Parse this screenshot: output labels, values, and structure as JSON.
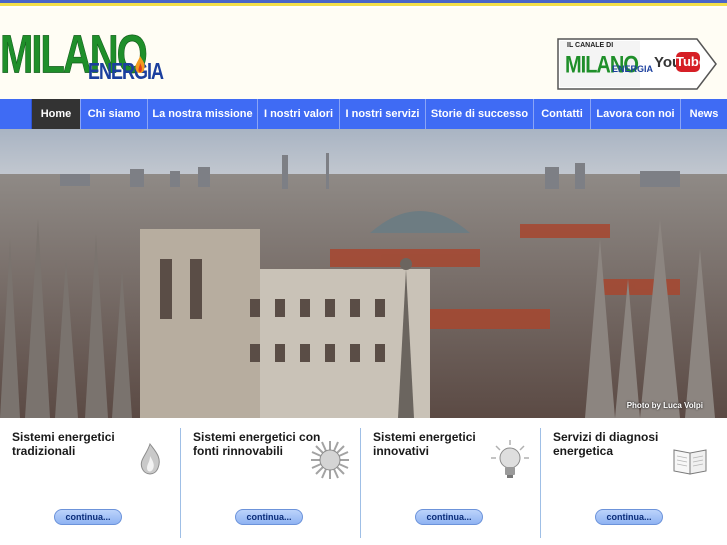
{
  "header": {
    "logo": {
      "word1": "MILANO",
      "word2": "ENERGIA"
    },
    "youtube_badge": {
      "caption": "IL CANALE DI",
      "word1": "MILANO",
      "word2": "ENERGIA",
      "you": "You",
      "tube": "Tube"
    }
  },
  "nav": {
    "items": [
      {
        "label": "Home",
        "active": true
      },
      {
        "label": "Chi siamo"
      },
      {
        "label": "La nostra missione"
      },
      {
        "label": "I nostri valori"
      },
      {
        "label": "I nostri servizi"
      },
      {
        "label": "Storie di successo"
      },
      {
        "label": "Contatti"
      },
      {
        "label": "Lavora con noi"
      },
      {
        "label": "News"
      }
    ]
  },
  "hero": {
    "credit": "Photo by Luca Volpi"
  },
  "services": [
    {
      "title": "Sistemi energetici tradizionali",
      "icon": "flame-icon",
      "button": "continua..."
    },
    {
      "title": "Sistemi energetici con fonti rinnovabili",
      "icon": "sun-icon",
      "button": "continua..."
    },
    {
      "title": "Sistemi energetici innovativi",
      "icon": "lightbulb-icon",
      "button": "continua..."
    },
    {
      "title": "Servizi di diagnosi energetica",
      "icon": "book-icon",
      "button": "continua..."
    }
  ],
  "colors": {
    "nav_bg": "#3f6bf4",
    "nav_active": "#333333",
    "logo_green": "#1f8f2a",
    "logo_blue": "#1b3f9e",
    "divider": "#9fbfe6"
  }
}
